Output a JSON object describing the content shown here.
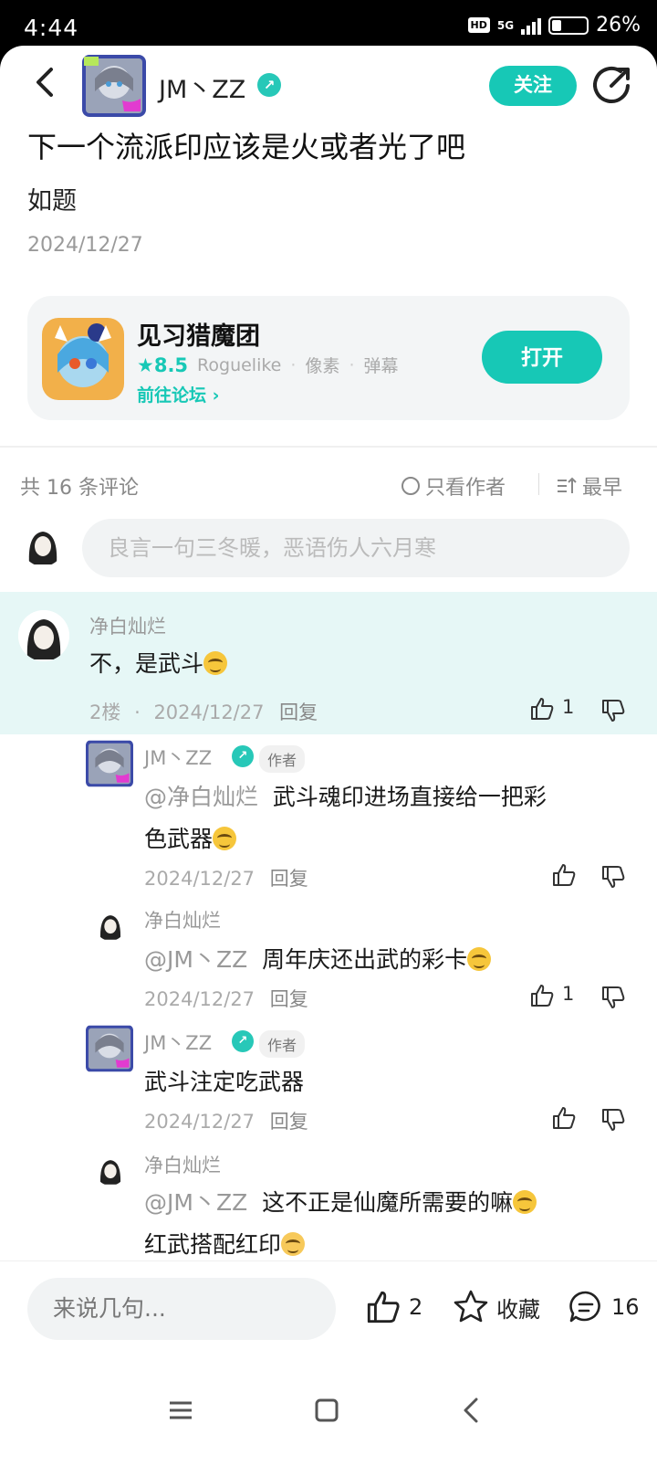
{
  "status_bar": {
    "time": "4:44",
    "hd": "HD",
    "network": "5G",
    "battery": "26%"
  },
  "header": {
    "author_name": "JM丶ZZ",
    "follow_label": "关注"
  },
  "post": {
    "title": "下一个流派印应该是火或者光了吧",
    "body": "如题",
    "date": "2024/12/27"
  },
  "game": {
    "name": "见习猎魔团",
    "rating": "8.5",
    "tags": [
      "Roguelike",
      "像素",
      "弹幕"
    ],
    "forum_link": "前往论坛",
    "open_label": "打开"
  },
  "comments_header": {
    "count_text": "共 16 条评论",
    "only_author": "只看作者",
    "sort": "最早"
  },
  "composer": {
    "placeholder": "良言一句三冬暖，恶语伤人六月寒"
  },
  "comments": [
    {
      "user": "净白灿烂",
      "text": "不，是武斗",
      "floor": "2楼",
      "date": "2024/12/27",
      "reply": "回复",
      "likes": "1"
    }
  ],
  "replies": [
    {
      "user": "JM丶ZZ",
      "tag": "作者",
      "mention": "@净白灿烂",
      "text_line1": "武斗魂印进场直接给一把彩",
      "text_line2": "色武器",
      "date": "2024/12/27",
      "reply": "回复",
      "likes": ""
    },
    {
      "user": "净白灿烂",
      "mention": "@JM丶ZZ",
      "text": "周年庆还出武的彩卡",
      "date": "2024/12/27",
      "reply": "回复",
      "likes": "1"
    },
    {
      "user": "JM丶ZZ",
      "tag": "作者",
      "text": "武斗注定吃武器",
      "date": "2024/12/27",
      "reply": "回复",
      "likes": ""
    },
    {
      "user": "净白灿烂",
      "mention": "@JM丶ZZ",
      "text_line1": "这不正是仙魔所需要的嘛",
      "text_line2": "红武搭配红印"
    }
  ],
  "bottom_bar": {
    "input_placeholder": "来说几句...",
    "likes": "2",
    "favorite": "收藏",
    "comments": "16"
  },
  "colors": {
    "accent": "#17c8b6",
    "highlight_bg": "#e6f7f6"
  }
}
